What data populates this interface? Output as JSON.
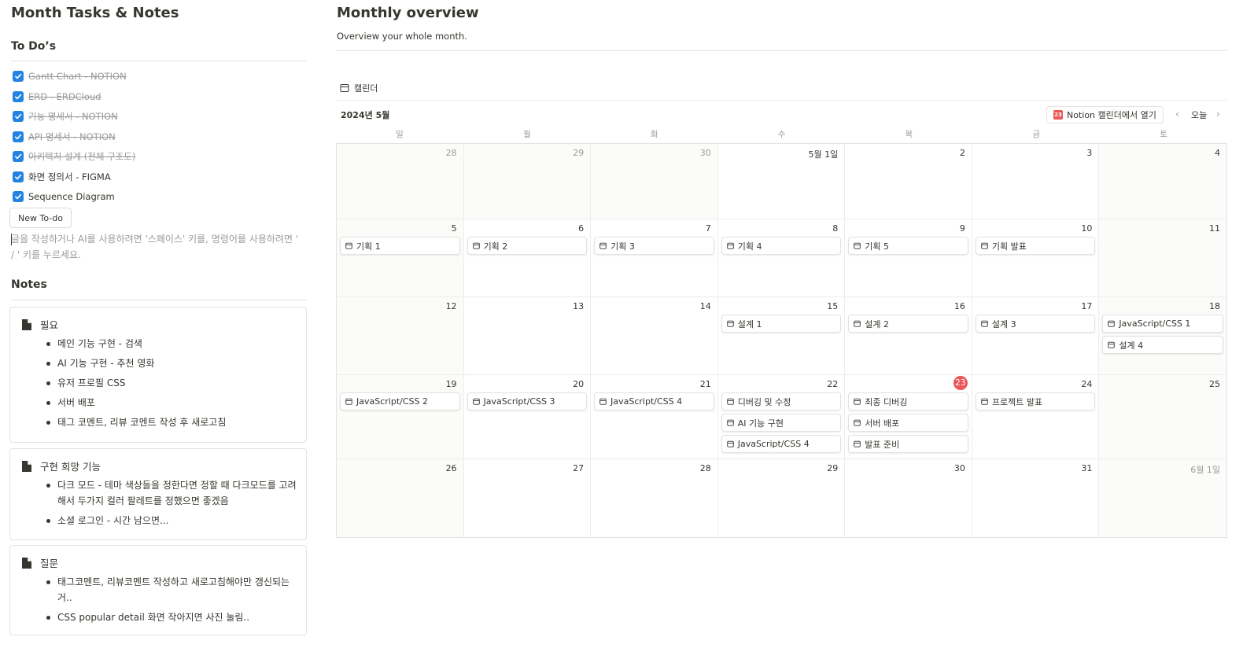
{
  "left": {
    "title": "Month Tasks & Notes",
    "todos_heading": "To Do’s",
    "todos": [
      {
        "label": "Gantt Chart - NOTION",
        "checked": true,
        "strikethrough": true
      },
      {
        "label": "ERD - ERDCloud",
        "checked": true,
        "strikethrough": true
      },
      {
        "label": "기능 명세서 - NOTION",
        "checked": true,
        "strikethrough": true
      },
      {
        "label": "API 명세서 - NOTION",
        "checked": true,
        "strikethrough": true
      },
      {
        "label": "아키텍처 설계 (전체 구조도)",
        "checked": true,
        "strikethrough": true
      },
      {
        "label": "화면 정의서 - FIGMA",
        "checked": true,
        "strikethrough": false
      },
      {
        "label": "Sequence Diagram",
        "checked": true,
        "strikethrough": false
      }
    ],
    "new_todo_label": "New To-do",
    "editor_placeholder": "글을 작성하거나 AI를 사용하려면 '스페이스' 키를, 명령어를 사용하려면 ' / ' 키를 누르세요.",
    "notes_heading": "Notes",
    "notes": [
      {
        "title": "필요",
        "items": [
          "메인 기능 구현 - 검색",
          "AI 기능 구현 - 추천 영화",
          "유저 프로필 CSS",
          "서버 배포",
          "태그 코멘트, 리뷰 코멘트 작성 후 새로고침"
        ]
      },
      {
        "title": "구현 희망 기능",
        "items": [
          "다크 모드 - 테마 색상들을 정한다면 정할 때 다크모드를 고려해서 두가지 컬러 팔레트를 정했으면 좋겠음",
          "소셜 로그인 - 시간 남으면..."
        ]
      },
      {
        "title": "질문",
        "items": [
          "태그코멘트, 리뷰코멘트 작성하고 새로고침해야만 갱신되는 거..",
          "CSS popular detail 화면 작아지면 사진 눌림.."
        ]
      }
    ]
  },
  "overview": {
    "title": "Monthly overview",
    "subtitle": "Overview your whole month.",
    "view_tab": "캘린더",
    "month_label": "2024년 5월",
    "open_in_calendar": "Notion 캘린더에서 열기",
    "calendar_badge": "23",
    "prev": "‹",
    "today": "오늘",
    "next": "›",
    "weekdays": [
      "일",
      "월",
      "화",
      "수",
      "목",
      "금",
      "토"
    ],
    "today_day": "23",
    "colors": {
      "accent": "#2383e2",
      "today": "#eb5757",
      "border": "#e3e2e0"
    },
    "weeks": [
      [
        {
          "label": "28",
          "outside": true,
          "events": []
        },
        {
          "label": "29",
          "outside": true,
          "events": []
        },
        {
          "label": "30",
          "outside": true,
          "events": []
        },
        {
          "label": "5월 1일",
          "outside": false,
          "events": []
        },
        {
          "label": "2",
          "outside": false,
          "events": []
        },
        {
          "label": "3",
          "outside": false,
          "events": []
        },
        {
          "label": "4",
          "outside": false,
          "events": []
        }
      ],
      [
        {
          "label": "5",
          "outside": false,
          "events": [
            "기획 1"
          ]
        },
        {
          "label": "6",
          "outside": false,
          "events": [
            "기획 2"
          ]
        },
        {
          "label": "7",
          "outside": false,
          "events": [
            "기획 3"
          ]
        },
        {
          "label": "8",
          "outside": false,
          "events": [
            "기획 4"
          ]
        },
        {
          "label": "9",
          "outside": false,
          "events": [
            "기획 5"
          ]
        },
        {
          "label": "10",
          "outside": false,
          "events": [
            "기획 발표"
          ]
        },
        {
          "label": "11",
          "outside": false,
          "events": []
        }
      ],
      [
        {
          "label": "12",
          "outside": false,
          "events": []
        },
        {
          "label": "13",
          "outside": false,
          "events": []
        },
        {
          "label": "14",
          "outside": false,
          "events": []
        },
        {
          "label": "15",
          "outside": false,
          "events": [
            "설계 1"
          ]
        },
        {
          "label": "16",
          "outside": false,
          "events": [
            "설계 2"
          ]
        },
        {
          "label": "17",
          "outside": false,
          "events": [
            "설계 3"
          ]
        },
        {
          "label": "18",
          "outside": false,
          "events": [
            "JavaScript/CSS 1",
            "설계 4"
          ]
        }
      ],
      [
        {
          "label": "19",
          "outside": false,
          "events": [
            "JavaScript/CSS 2"
          ]
        },
        {
          "label": "20",
          "outside": false,
          "events": [
            "JavaScript/CSS 3"
          ]
        },
        {
          "label": "21",
          "outside": false,
          "events": [
            "JavaScript/CSS 4"
          ]
        },
        {
          "label": "22",
          "outside": false,
          "events": [
            "디버깅 및 수정",
            "AI 기능 구현",
            "JavaScript/CSS 4"
          ]
        },
        {
          "label": "23",
          "outside": false,
          "events": [
            "최종 디버깅",
            "서버 배포",
            "발표 준비"
          ]
        },
        {
          "label": "24",
          "outside": false,
          "events": [
            "프로젝트 발표"
          ]
        },
        {
          "label": "25",
          "outside": false,
          "events": []
        }
      ],
      [
        {
          "label": "26",
          "outside": false,
          "events": []
        },
        {
          "label": "27",
          "outside": false,
          "events": []
        },
        {
          "label": "28",
          "outside": false,
          "events": []
        },
        {
          "label": "29",
          "outside": false,
          "events": []
        },
        {
          "label": "30",
          "outside": false,
          "events": []
        },
        {
          "label": "31",
          "outside": false,
          "events": []
        },
        {
          "label": "6월 1일",
          "outside": true,
          "events": []
        }
      ]
    ]
  }
}
